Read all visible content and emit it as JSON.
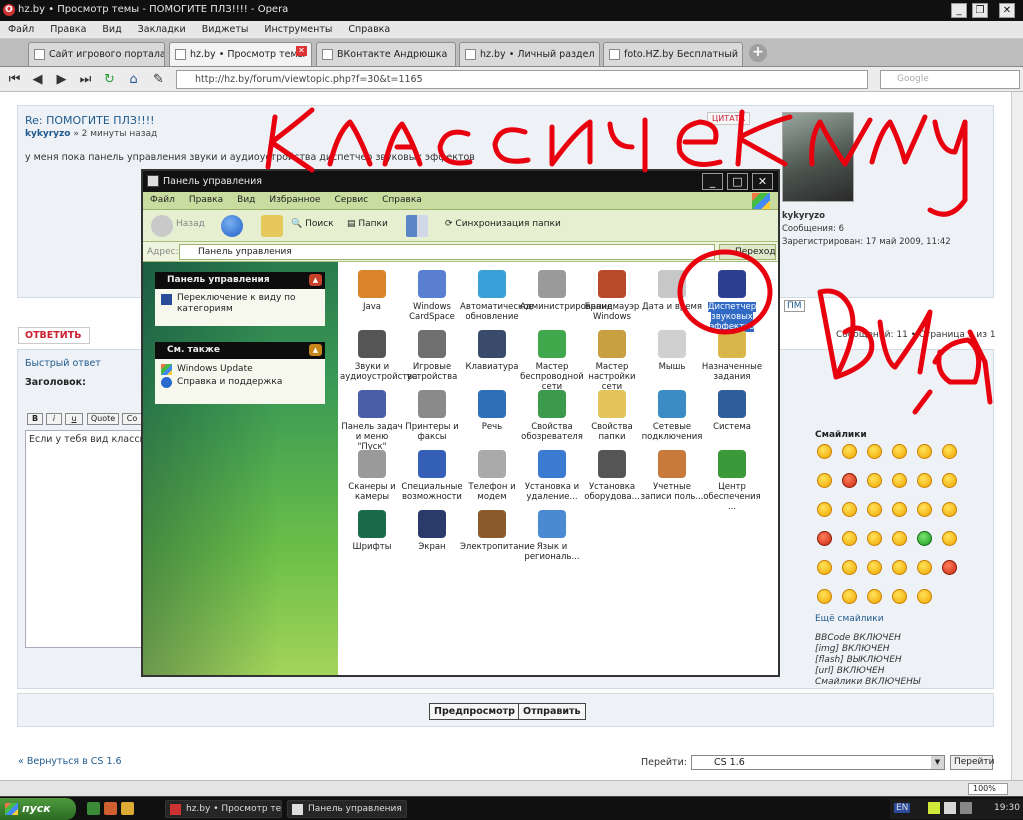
{
  "browser": {
    "title": "hz.by • Просмотр темы - ПОМОГИТЕ ПЛЗ!!!! - Opera",
    "app_icon": "opera-icon",
    "menu": [
      "Файл",
      "Правка",
      "Вид",
      "Закладки",
      "Виджеты",
      "Инструменты",
      "Справка"
    ],
    "tabs": [
      {
        "label": "Сайт игрового портала"
      },
      {
        "label": "hz.by • Просмотр темы"
      },
      {
        "label": "ВКонтакте  Андрюшка"
      },
      {
        "label": "hz.by • Личный раздел"
      },
      {
        "label": "foto.HZ.by  Бесплатный"
      }
    ],
    "address": "http://hz.by/forum/viewtopic.php?f=30&t=1165",
    "search_placeholder": "Google"
  },
  "post": {
    "title": "Re: ПОМОГИТЕ ПЛЗ!!!!",
    "author": "kykyryzo",
    "time": "» 2 минуты назад",
    "text": "у меня пока панель управления звуки и аудиоустройства диспетчер звуковых эффектов",
    "quote_button": "ЦИТАТА",
    "profile": {
      "name": "kykyryzo",
      "messages": "Сообщения: 6",
      "registered": "Зарегистрирован: 17 май 2009, 11:42"
    }
  },
  "actions": {
    "reply": "ОТВЕТИТЬ",
    "quick_reply": "Быстрый ответ",
    "subject_label": "Заголовок:",
    "message_text": "Если у тебя вид класси...",
    "format_buttons": [
      "B",
      "i",
      "u",
      "Quote",
      "Co"
    ],
    "pager": "Сообщений: 11 • Страница 1 из 1",
    "preview": "Предпросмотр",
    "submit": "Отправить",
    "back_link": "« Вернуться в CS 1.6",
    "jump_label": "Перейти:",
    "jump_value": "CS 1.6",
    "go": "Перейти"
  },
  "smilies": {
    "heading": "Смайлики",
    "more": "Ещё смайлики",
    "status_lines": [
      "BBCode ВКЛЮЧЕН",
      "[img] ВКЛЮЧЕН",
      "[flash] ВЫКЛЮЧЕН",
      "[url] ВКЛЮЧЕН",
      "Смайлики ВКЛЮЧЕНЫ"
    ]
  },
  "control_panel": {
    "title": "Панель управления",
    "menu": [
      "Файл",
      "Правка",
      "Вид",
      "Избранное",
      "Сервис",
      "Справка"
    ],
    "toolbar": {
      "back": "Назад",
      "search": "Поиск",
      "folders": "Папки",
      "sync": "Синхронизация папки"
    },
    "address_label": "Адрес:",
    "address_value": "Панель управления",
    "go": "Переход",
    "side_box1": {
      "title": "Панель управления",
      "link": "Переключение к виду по категориям"
    },
    "side_box2": {
      "title": "См. также",
      "links": [
        "Windows Update",
        "Справка и поддержка"
      ]
    },
    "items": [
      {
        "label": "Java",
        "icon": "java-icon",
        "color": "#d9832b"
      },
      {
        "label": "Windows CardSpace",
        "icon": "cardspace-icon",
        "color": "#5a7fd0"
      },
      {
        "label": "Автоматическое обновление",
        "icon": "update-icon",
        "color": "#3aa0d8"
      },
      {
        "label": "Администрирование",
        "icon": "admin-tools-icon",
        "color": "#9a9a9a"
      },
      {
        "label": "Брандмауэр Windows",
        "icon": "firewall-icon",
        "color": "#b84a2a"
      },
      {
        "label": "Дата и время",
        "icon": "clock-icon",
        "color": "#c7c7c7"
      },
      {
        "label": "Диспетчер звуковых эффектов",
        "icon": "sound-effects-icon",
        "color": "#2c3e8f"
      },
      {
        "label": "Звуки и аудиоустройства",
        "icon": "sound-icon",
        "color": "#555555"
      },
      {
        "label": "Игровые устройства",
        "icon": "gamepad-icon",
        "color": "#6f6f6f"
      },
      {
        "label": "Клавиатура",
        "icon": "keyboard-icon",
        "color": "#3a4a6a"
      },
      {
        "label": "Мастер беспроводной сети",
        "icon": "wireless-icon",
        "color": "#3fa84a"
      },
      {
        "label": "Мастер настройки сети",
        "icon": "network-setup-icon",
        "color": "#c8a040"
      },
      {
        "label": "Мышь",
        "icon": "mouse-icon",
        "color": "#d0d0d0"
      },
      {
        "label": "Назначенные задания",
        "icon": "scheduled-tasks-icon",
        "color": "#d9b64a"
      },
      {
        "label": "Панель задач и меню \"Пуск\"",
        "icon": "taskbar-icon",
        "color": "#4a5ea8"
      },
      {
        "label": "Принтеры и факсы",
        "icon": "printer-icon",
        "color": "#8a8a8a"
      },
      {
        "label": "Речь",
        "icon": "speech-icon",
        "color": "#2f6fb8"
      },
      {
        "label": "Свойства обозревателя",
        "icon": "internet-options-icon",
        "color": "#3c9a4c"
      },
      {
        "label": "Свойства папки",
        "icon": "folder-options-icon",
        "color": "#e3c35a"
      },
      {
        "label": "Сетевые подключения",
        "icon": "network-connections-icon",
        "color": "#3b8bc4"
      },
      {
        "label": "Система",
        "icon": "system-icon",
        "color": "#2f5d9a"
      },
      {
        "label": "Сканеры и камеры",
        "icon": "scanner-icon",
        "color": "#9a9a9a"
      },
      {
        "label": "Специальные возможности",
        "icon": "accessibility-icon",
        "color": "#3460b8"
      },
      {
        "label": "Телефон и модем",
        "icon": "phone-modem-icon",
        "color": "#aaaaaa"
      },
      {
        "label": "Установка и удаление...",
        "icon": "add-remove-icon",
        "color": "#3a7ad0"
      },
      {
        "label": "Установка оборудова...",
        "icon": "hardware-icon",
        "color": "#555555"
      },
      {
        "label": "Учетные записи поль...",
        "icon": "user-accounts-icon",
        "color": "#c77a3a"
      },
      {
        "label": "Центр обеспечения ...",
        "icon": "security-center-icon",
        "color": "#3a9a3a"
      },
      {
        "label": "Шрифты",
        "icon": "fonts-icon",
        "color": "#1a6a4a"
      },
      {
        "label": "Экран",
        "icon": "display-icon",
        "color": "#2a3a6a"
      },
      {
        "label": "Электропитание",
        "icon": "power-icon",
        "color": "#8a5a2a"
      },
      {
        "label": "Язык и региональ...",
        "icon": "regional-icon",
        "color": "#4a8ad0"
      }
    ]
  },
  "handwriting": {
    "line1": "классический",
    "line2": "вид",
    "color": "#e8000f"
  },
  "status": {
    "zoom": "100%"
  },
  "taskbar": {
    "start": "пуск",
    "items": [
      "hz.by • Просмотр те...",
      "Панель управления"
    ],
    "tray": {
      "lang": "EN",
      "time": "19:30"
    }
  }
}
